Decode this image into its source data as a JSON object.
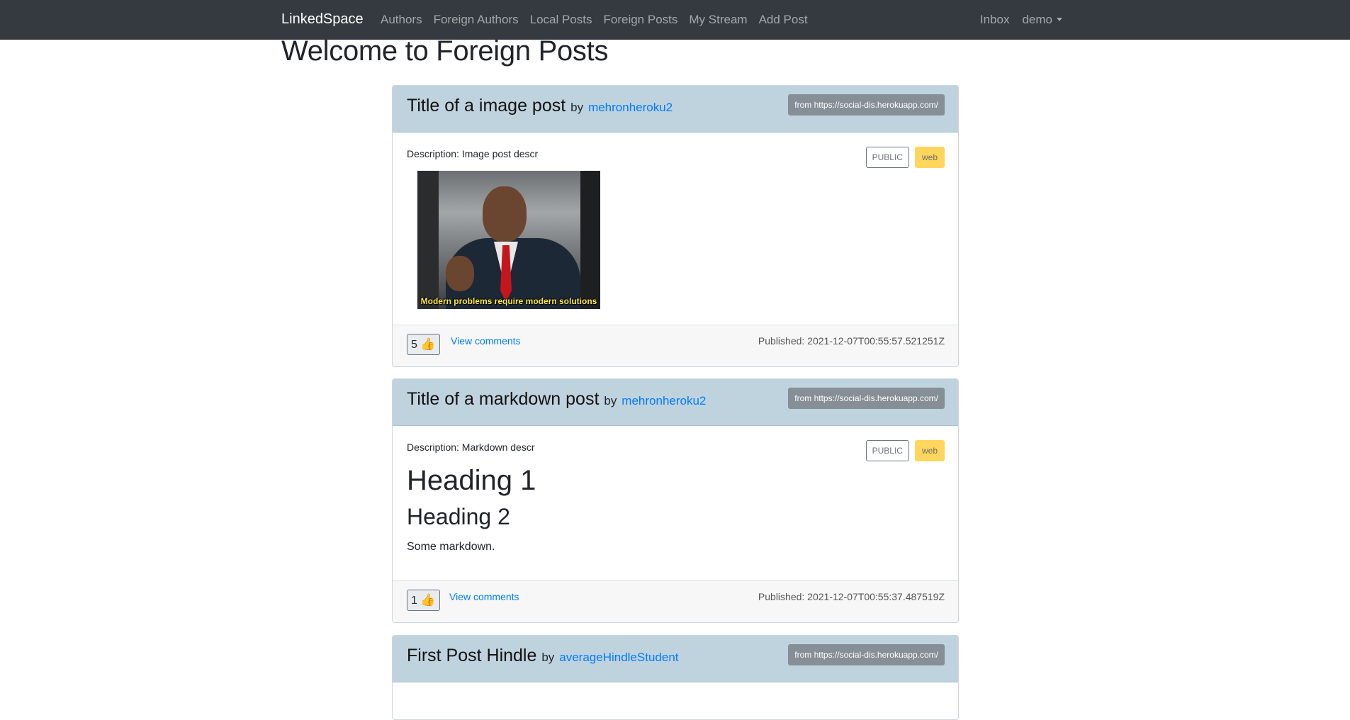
{
  "navbar": {
    "brand": "LinkedSpace",
    "links": [
      "Authors",
      "Foreign Authors",
      "Local Posts",
      "Foreign Posts",
      "My Stream",
      "Add Post"
    ],
    "inbox": "Inbox",
    "user": "demo"
  },
  "page_title": "Welcome to Foreign Posts",
  "posts": [
    {
      "title": "Title of a image post",
      "by": "by",
      "author": "mehronheroku2",
      "origin": "from https://social-dis.herokuapp.com/",
      "description": "Description: Image post descr",
      "visibility": "PUBLIC",
      "tag": "web",
      "image_caption": "Modern problems require modern solutions",
      "likes": "5",
      "like_icon": "👍",
      "view_comments": "View comments",
      "published": "Published: 2021-12-07T00:55:57.521251Z"
    },
    {
      "title": "Title of a markdown post",
      "by": "by",
      "author": "mehronheroku2",
      "origin": "from https://social-dis.herokuapp.com/",
      "description": "Description: Markdown descr",
      "visibility": "PUBLIC",
      "tag": "web",
      "markdown": {
        "h1": "Heading 1",
        "h2": "Heading 2",
        "p": "Some markdown."
      },
      "likes": "1",
      "like_icon": "👍",
      "view_comments": "View comments",
      "published": "Published: 2021-12-07T00:55:37.487519Z"
    },
    {
      "title": "First Post Hindle",
      "by": "by",
      "author": "averageHindleStudent",
      "origin": "from https://social-dis.herokuapp.com/"
    }
  ],
  "colors": {
    "navbar_bg": "#343a40",
    "card_header_bg": "#bfd3de",
    "link": "#007bff",
    "tag_web_bg": "#ffd65c",
    "origin_badge_bg": "#868e96"
  }
}
